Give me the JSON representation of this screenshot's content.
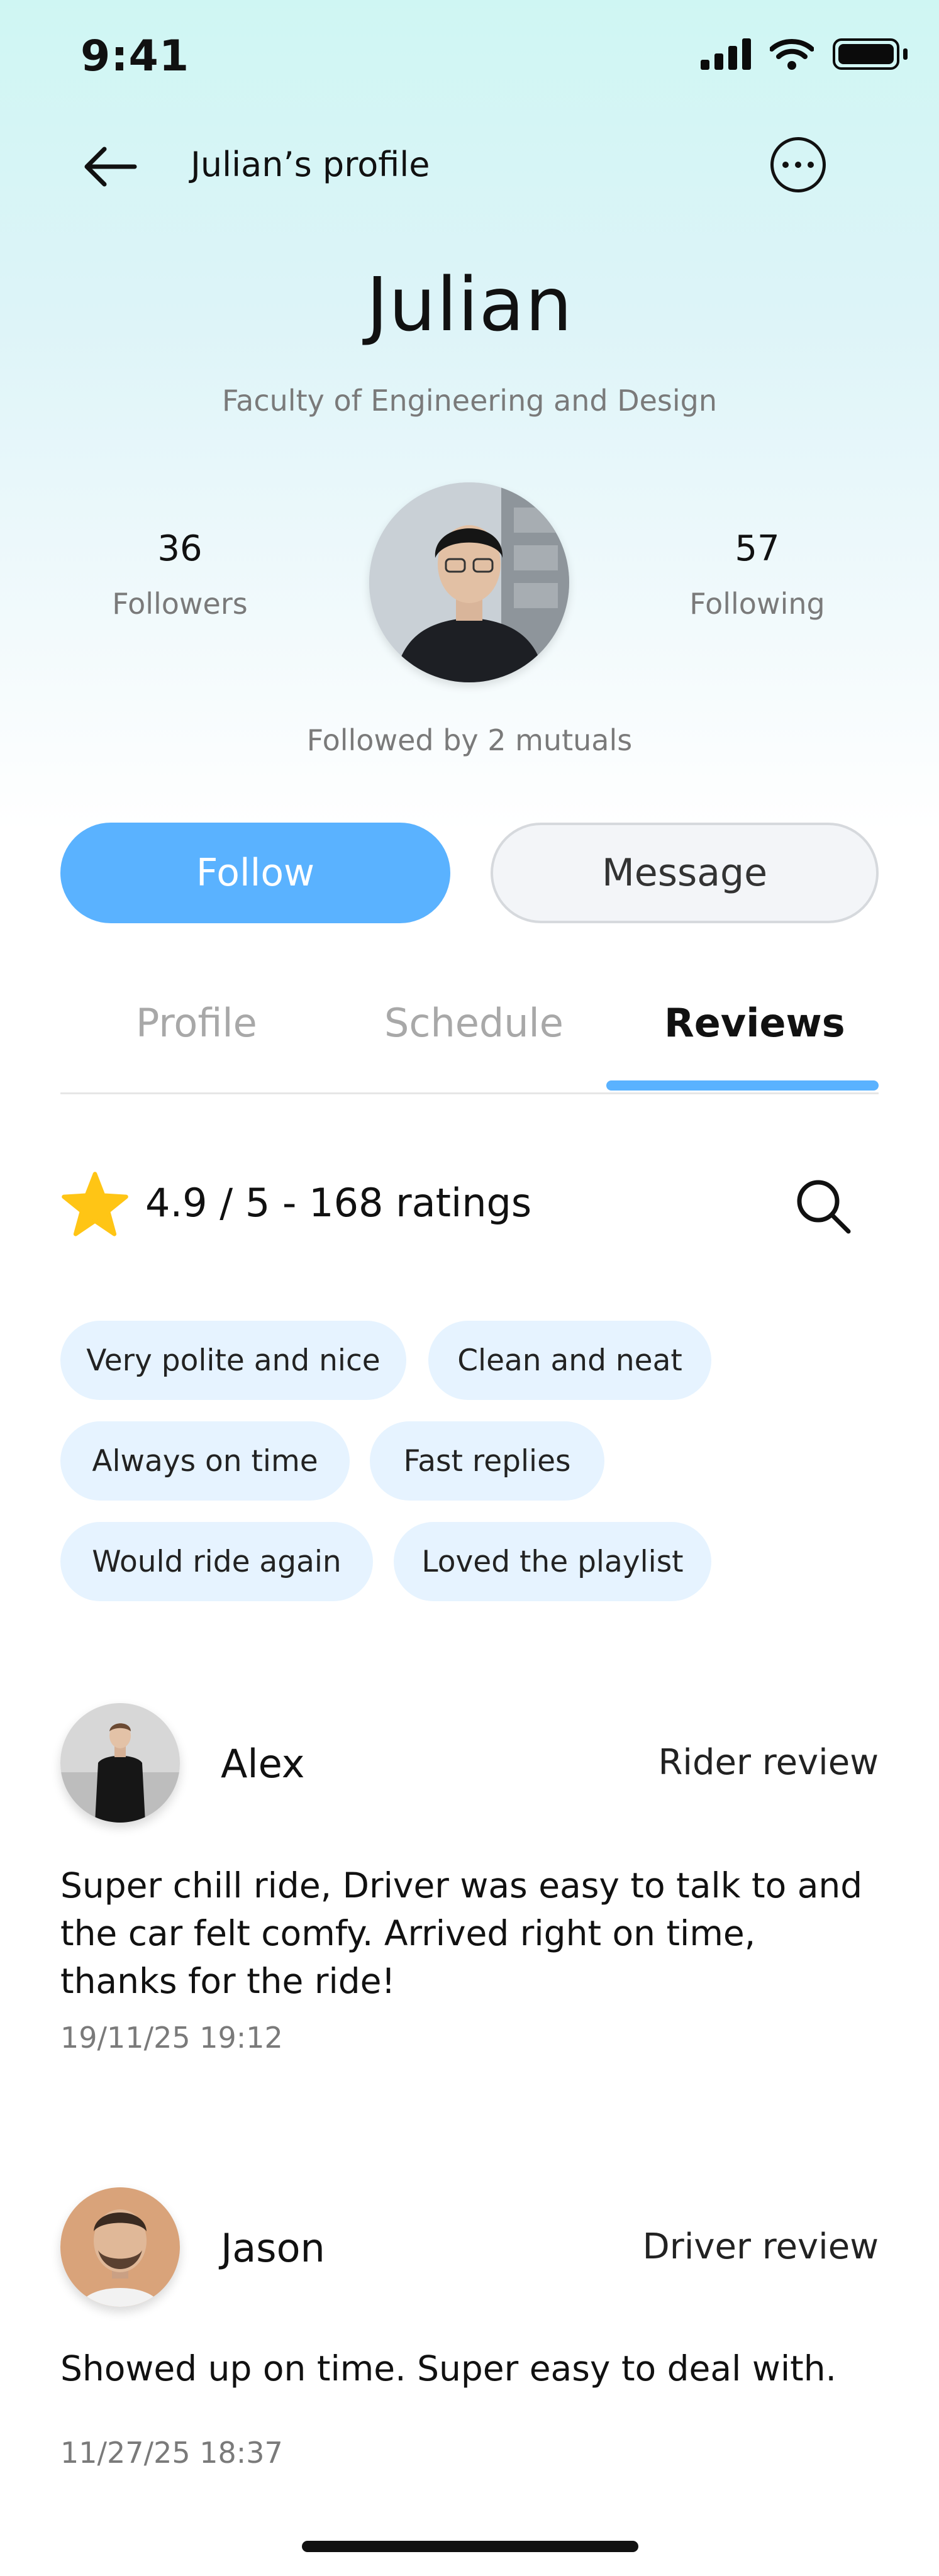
{
  "status_bar": {
    "time": "9:41"
  },
  "nav": {
    "title": "Julian’s profile"
  },
  "profile": {
    "name": "Julian",
    "faculty": "Faculty of Engineering and Design",
    "followers_count": "36",
    "followers_label": "Followers",
    "following_count": "57",
    "following_label": "Following",
    "mutuals": "Followed by 2 mutuals"
  },
  "actions": {
    "follow": "Follow",
    "message": "Message"
  },
  "tabs": [
    {
      "label": "Profile"
    },
    {
      "label": "Schedule"
    },
    {
      "label": "Reviews",
      "active": true
    }
  ],
  "rating": {
    "summary": "4.9 / 5 - 168 ratings"
  },
  "chips": [
    "Very polite and nice",
    "Clean and neat",
    "Always on time",
    "Fast replies",
    "Would ride again",
    "Loved the playlist"
  ],
  "reviews": [
    {
      "name": "Alex",
      "type": "Rider review",
      "text": "Super chill ride, Driver was easy to talk to and the car felt comfy. Arrived right on time, thanks for the ride!",
      "date": "19/11/25 19:12"
    },
    {
      "name": "Jason",
      "type": "Driver review",
      "text": "Showed up on time. Super easy to deal with.",
      "date": "11/27/25 18:37"
    }
  ],
  "colors": {
    "accent": "#5AB2FF",
    "chip_bg": "#E6F3FF",
    "star": "#FFC515"
  },
  "icons": [
    "back-arrow-icon",
    "more-options-icon",
    "star-icon",
    "search-icon",
    "cellular-signal-icon",
    "wifi-icon",
    "battery-icon"
  ]
}
